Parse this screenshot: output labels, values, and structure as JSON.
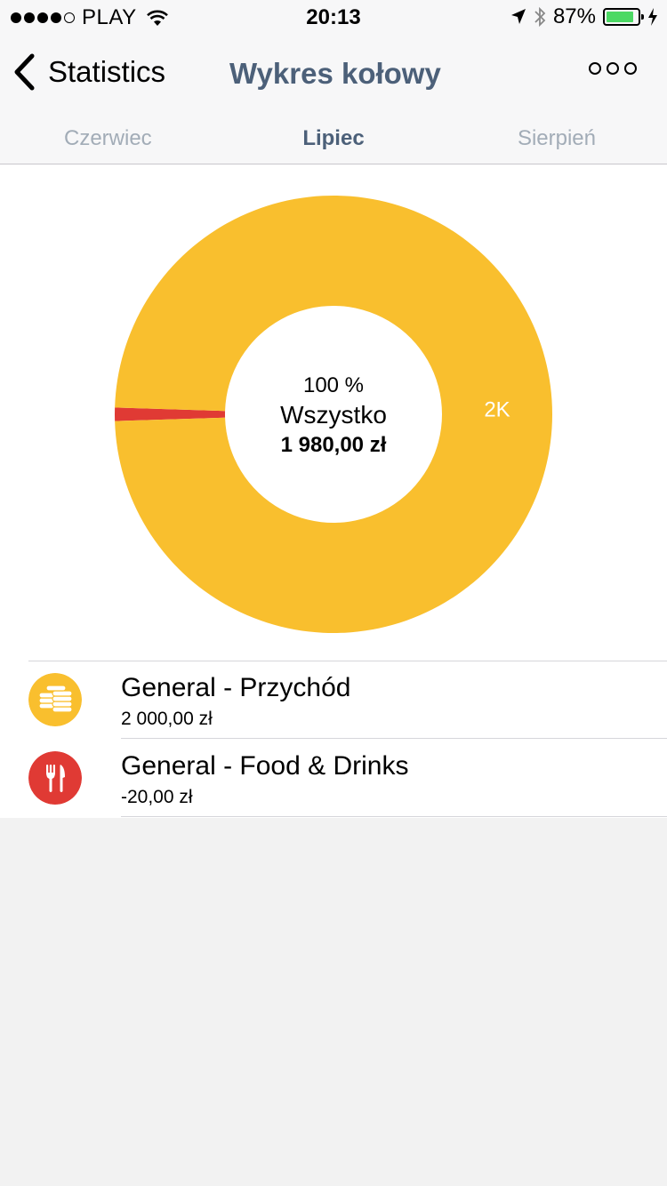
{
  "status_bar": {
    "carrier": "PLAY",
    "time": "20:13",
    "battery_percent_text": "87%",
    "battery_level": 0.87
  },
  "nav": {
    "back_label": "Statistics",
    "title": "Wykres kołowy"
  },
  "tabs": {
    "prev": "Czerwiec",
    "current": "Lipiec",
    "next": "Sierpień"
  },
  "chart_data": {
    "type": "pie",
    "donut": true,
    "center": {
      "percent": "100 %",
      "label": "Wszystko",
      "amount": "1 980,00 zł"
    },
    "slices": [
      {
        "name": "General - Przychód",
        "value": 2000,
        "color": "#f9bf2e",
        "label": "2K"
      },
      {
        "name": "General - Food & Drinks",
        "value": 20,
        "color": "#e03a34",
        "label": ""
      }
    ]
  },
  "list": [
    {
      "title": "General - Przychód",
      "amount": "2 000,00 zł",
      "icon": "coins-icon",
      "color": "#f9bf2e"
    },
    {
      "title": "General - Food & Drinks",
      "amount": "-20,00 zł",
      "icon": "fork-knife-icon",
      "color": "#e03a34"
    }
  ]
}
